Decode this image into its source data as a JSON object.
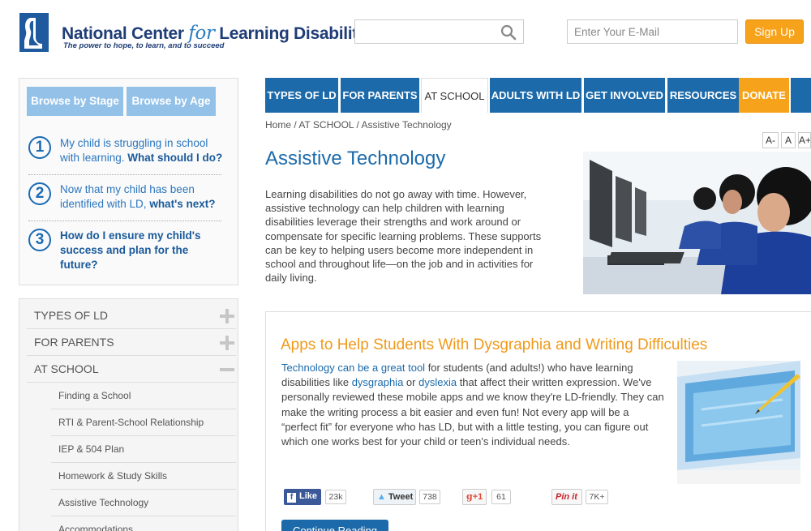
{
  "header": {
    "logo_name_part1": "National Center ",
    "logo_name_for": "for",
    "logo_name_part2": " Learning Disabilities",
    "tagline": "The power to hope, to learn, and to succeed",
    "search_placeholder": "",
    "email_placeholder": "Enter Your E-Mail",
    "signup_label": "Sign Up"
  },
  "browse": {
    "tabs": [
      "Browse by Stage",
      "Browse by Age"
    ],
    "questions": [
      {
        "num": "1",
        "text": "My child is struggling in school with learning. ",
        "bold": "What should I do?"
      },
      {
        "num": "2",
        "text": "Now that my child has been identified with LD, ",
        "bold": "what's next?"
      },
      {
        "num": "3",
        "text": "",
        "bold": "How do I ensure my child's success and plan for the future?"
      }
    ]
  },
  "side_nav": {
    "main": [
      "TYPES OF LD",
      "FOR PARENTS",
      "AT SCHOOL"
    ],
    "sub": [
      "Finding a School",
      "RTI & Parent-School Relationship",
      "IEP & 504 Plan",
      "Homework & Study Skills",
      "Assistive Technology",
      "Accommodations"
    ]
  },
  "top_nav": [
    "TYPES OF LD",
    "FOR PARENTS",
    "AT SCHOOL",
    "ADULTS WITH LD",
    "GET INVOLVED",
    "RESOURCES",
    "DONATE"
  ],
  "breadcrumb": {
    "home": "Home",
    "section": "AT SCHOOL",
    "current": "Assistive Technology",
    "sep": " / "
  },
  "font_sizer": [
    "A-",
    "A",
    "A+"
  ],
  "page": {
    "title": "Assistive Technology",
    "intro": "Learning disabilities do not go away with time. However, assistive technology can help children with learning disabilities leverage their strengths and work around or compensate for specific learning problems. These supports can be key to helping users become more independent in school and throughout life—on the job and in activities for daily living."
  },
  "article": {
    "title": "Apps to Help Students With Dysgraphia and Writing Difficulties",
    "link1": "Technology can be a great tool",
    "text1": " for students (and adults!) who have learning disabilities like ",
    "link2": "dysgraphia",
    "text2": " or ",
    "link3": "dyslexia",
    "text3": " that affect their written expression. We've personally reviewed these mobile apps and we know they're LD-friendly. They can make the writing process a bit easier and even fun! Not every app will be a “perfect fit” for everyone who has LD, but with a little testing, you can figure out which one works best for your child or teen's individual needs.",
    "continue_label": "Continue Reading"
  },
  "share": {
    "facebook": {
      "label": "Like",
      "count": "23k"
    },
    "twitter": {
      "label": "Tweet",
      "count": "738"
    },
    "gplus": {
      "label": "+1",
      "count": "61"
    },
    "pinterest": {
      "label": "Pin it",
      "count": "7K+"
    }
  },
  "colors": {
    "brand_blue": "#1c6aaa",
    "accent_orange": "#f6a21a",
    "light_blue": "#93c1e8"
  }
}
